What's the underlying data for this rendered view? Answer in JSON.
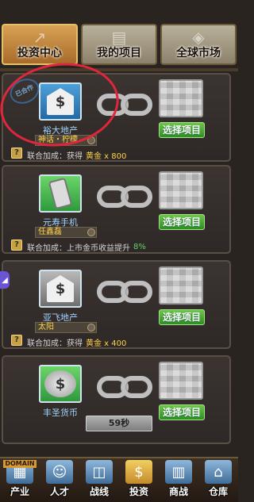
{
  "top_tabs": [
    {
      "label": "投资中心",
      "active": true
    },
    {
      "label": "我的项目",
      "active": false
    },
    {
      "label": "全球市场",
      "active": false
    }
  ],
  "cards": [
    {
      "icon": "bank-icon",
      "stamp": "已合作",
      "name": "裕大地产",
      "owner": "神话・柠檬",
      "bonus_prefix": "联合加成：获得",
      "bonus_value": "黄金 x 800",
      "select_label": "选择项目"
    },
    {
      "icon": "phone-icon",
      "name": "元寿手机",
      "owner": "任鑫磊",
      "bonus_prefix": "联合加成：上市金币收益提升",
      "bonus_value": "8%",
      "select_label": "选择项目"
    },
    {
      "icon": "bank-icon",
      "name": "亚飞地产",
      "owner": "太阳",
      "bonus_prefix": "联合加成：获得",
      "bonus_value": "黄金 x 400",
      "select_label": "选择项目"
    },
    {
      "icon": "coins-icon",
      "name": "丰圣货币",
      "owner": "",
      "bonus_prefix": "",
      "bonus_value": "",
      "select_label": "选择项目"
    }
  ],
  "timer": "59秒",
  "bottom_nav": [
    {
      "label": "产业",
      "tag": "DOMAIN",
      "active": false
    },
    {
      "label": "人才",
      "active": false
    },
    {
      "label": "战线",
      "active": false
    },
    {
      "label": "投资",
      "active": true
    },
    {
      "label": "商战",
      "active": false
    },
    {
      "label": "仓库",
      "active": false
    }
  ]
}
